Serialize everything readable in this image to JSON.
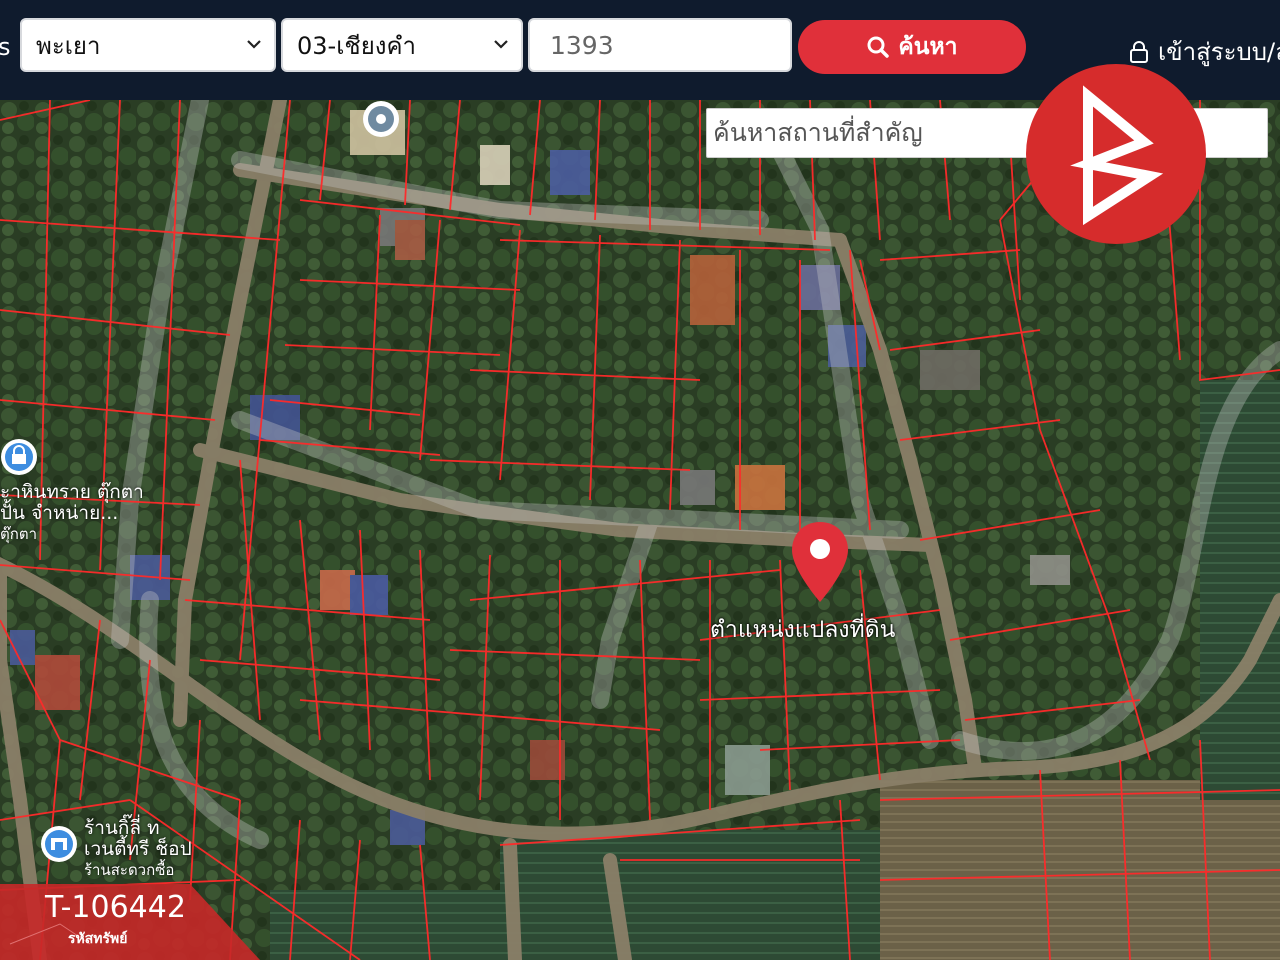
{
  "header": {
    "edge_text": "s",
    "province": "พะเยา",
    "district": "03-เชียงคำ",
    "parcel_number": "1393",
    "search_label": "ค้นหา",
    "login_label": "เข้าสู่ระบบ/ล"
  },
  "map": {
    "landmark_placeholder": "ค้นหาสถานที่สำคัญ",
    "pin_label": "ตำแหน่งแปลงที่ดิน",
    "poi": [
      {
        "line1": "ะาหินทราย ตุ๊กตา",
        "line2": "ปั้น จำหน่าย...",
        "line3": "ตุ๊กตา"
      },
      {
        "line1": "ร้านกิ๊ลี่ ท",
        "line2": "เวนตี้ทรี ช็อป",
        "line3": "ร้านสะดวกซื้อ"
      }
    ]
  },
  "asset": {
    "code": "T-106442",
    "code_label": "รหัสทรัพย์"
  },
  "colors": {
    "header_bg": "#0f1b2d",
    "accent_red": "#e0303a",
    "parcel_line": "#ff2a2a",
    "logo_red": "#d62c2c"
  },
  "icons": [
    "chevron-down-icon",
    "search-icon",
    "lock-icon",
    "map-pin-icon",
    "logo-icon",
    "poi-location-icon",
    "poi-shop-icon"
  ]
}
